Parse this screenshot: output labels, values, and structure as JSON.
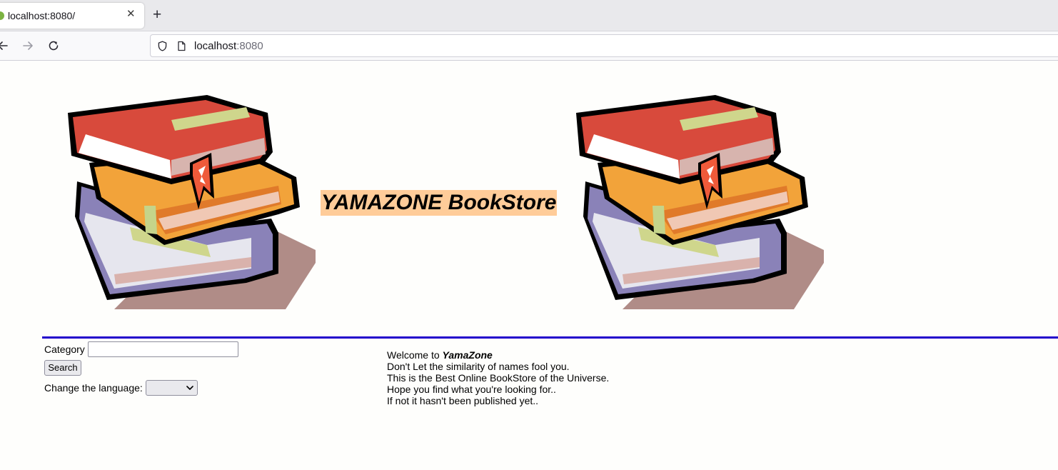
{
  "browser": {
    "tab_title": "localhost:8080/",
    "url_host": "localhost",
    "url_port": ":8080",
    "icons": [
      "favicon",
      "close-icon",
      "new-tab-icon",
      "back-icon",
      "forward-icon",
      "reload-icon",
      "shield-icon",
      "page-icon"
    ]
  },
  "header": {
    "title": "YAMAZONE BookStore",
    "title_background": "#ffcc99",
    "divider_color": "#2200cc"
  },
  "search": {
    "category_label": "Category",
    "category_value": "",
    "search_button": "Search",
    "language_label": "Change the language:",
    "language_selected": ""
  },
  "welcome": {
    "prefix": "Welcome to ",
    "brand": "YamaZone",
    "lines": [
      "Don't Let the similarity of names fool you.",
      "This is the Best Online BookStore of the Universe.",
      "Hope you find what you're looking for..",
      "If not it hasn't been published yet.."
    ]
  }
}
